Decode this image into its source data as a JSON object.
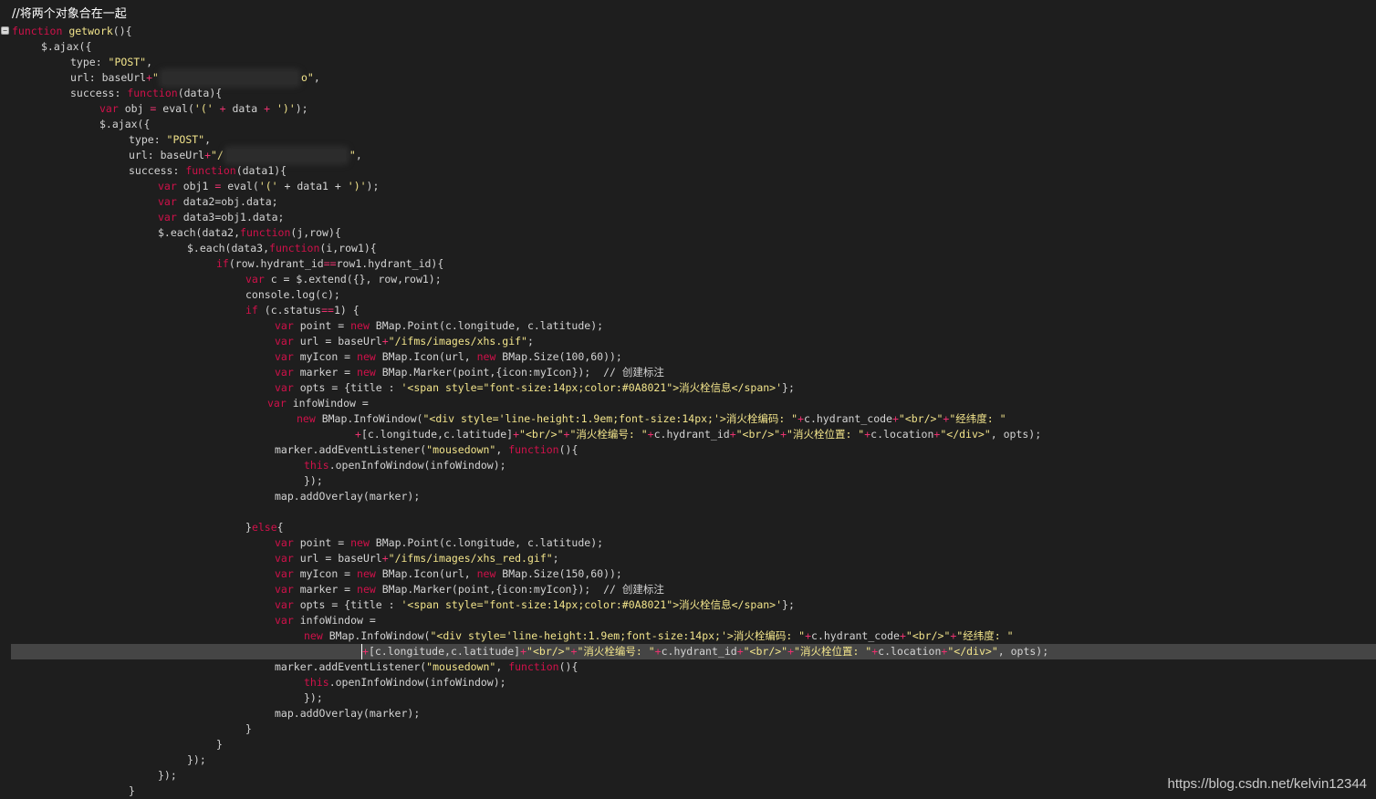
{
  "editor": {
    "header_comment": "//将两个对象合在一起",
    "watermark": "https://blog.csdn.net/kelvin12344"
  },
  "code": {
    "l2_kw": "function",
    "l2_name": "getwork",
    "l2_rest": "(){",
    "l3": "$.ajax({",
    "l4_a": "type: ",
    "l4_s": "\"POST\"",
    "l4_b": ",",
    "l5_a": "url: baseUrl",
    "l5_op": "+",
    "l5_s1": "\"",
    "l5_s2": "o\"",
    "l5_b": ",",
    "l6_a": "success: ",
    "l6_kw": "function",
    "l6_b": "(data){",
    "l7_kw": "var",
    "l7_a": " obj ",
    "l7_op": "=",
    "l7_b": " eval(",
    "l7_s1": "'('",
    "l7_c": " ",
    "l7_op2": "+",
    "l7_d": " data ",
    "l7_op3": "+",
    "l7_e": " ",
    "l7_s2": "')'",
    "l7_f": ");",
    "l8": "$.ajax({",
    "l9_a": "type: ",
    "l9_s": "\"POST\"",
    "l9_b": ",",
    "l10_a": "url: baseUrl",
    "l10_op": "+",
    "l10_s1": "\"/",
    "l10_s2": "\"",
    "l10_b": ",",
    "l11_a": "success: ",
    "l11_kw": "function",
    "l11_b": "(data1){",
    "l12_kw": "var",
    "l12_a": " obj1 ",
    "l12_op": "=",
    "l12_b": " eval(",
    "l12_s1": "'('",
    "l12_c": " + data1 + ",
    "l12_s2": "')'",
    "l12_d": ");",
    "l13_kw": "var",
    "l13_a": " data2=obj.data;",
    "l14_kw": "var",
    "l14_a": " data3=obj1.data;",
    "l15_a": "$.each(data2,",
    "l15_kw": "function",
    "l15_b": "(j,row){",
    "l16_a": "$.each(data3,",
    "l16_kw": "function",
    "l16_b": "(i,row1){",
    "l17_kw": "if",
    "l17_a": "(row.hydrant_id",
    "l17_op": "==",
    "l17_b": "row1.hydrant_id){",
    "l18_kw": "var",
    "l18_a": " c = $.extend({}, row,row1);",
    "l19": "console.log(c);",
    "l20_kw": "if",
    "l20_a": " (c.status",
    "l20_op": "==",
    "l20_b": "1) {",
    "l21_kw": "var",
    "l21_a": " point = ",
    "l21_kw2": "new",
    "l21_b": " BMap.Point(c.longitude, c.latitude);",
    "l22_kw": "var",
    "l22_a": " url = baseUrl",
    "l22_op": "+",
    "l22_s": "\"/ifms/images/xhs.gif\"",
    "l22_b": ";",
    "l23_kw": "var",
    "l23_a": " myIcon = ",
    "l23_kw2": "new",
    "l23_b": " BMap.Icon(url, ",
    "l23_kw3": "new",
    "l23_c": " BMap.Size(100,60));",
    "l24_kw": "var",
    "l24_a": " marker = ",
    "l24_kw2": "new",
    "l24_b": " BMap.Marker(point,{icon:myIcon});  ",
    "l24_cm": "// 创建标注",
    "l25_kw": "var",
    "l25_a": " opts = {title : ",
    "l25_s": "'<span style=\"font-size:14px;color:#0A8021\">消火栓信息</span>'",
    "l25_b": "};",
    "l26_kw": "var",
    "l26_a": " infoWindow =",
    "l27_kw": "new",
    "l27_a": " BMap.InfoWindow(",
    "l27_s1": "\"<div style='line-height:1.9em;font-size:14px;'>消火栓编码: \"",
    "l27_op": "+",
    "l27_b": "c.hydrant_code",
    "l27_op2": "+",
    "l27_s2": "\"<br/>\"",
    "l27_op3": "+",
    "l27_s3": "\"经纬度: \"",
    "l28_op": "+",
    "l28_a": "[c.longitude,c.latitude]",
    "l28_op2": "+",
    "l28_s1": "\"<br/>\"",
    "l28_op3": "+",
    "l28_s2": "\"消火栓编号: \"",
    "l28_op4": "+",
    "l28_b": "c.hydrant_id",
    "l28_op5": "+",
    "l28_s3": "\"<br/>\"",
    "l28_op6": "+",
    "l28_s4": "\"消火栓位置: \"",
    "l28_op7": "+",
    "l28_c": "c.location",
    "l28_op8": "+",
    "l28_s5": "\"</div>\"",
    "l28_d": ", opts);",
    "l29_a": "marker.addEventListener(",
    "l29_s": "\"mousedown\"",
    "l29_b": ", ",
    "l29_kw": "function",
    "l29_c": "(){",
    "l30_kw": "this",
    "l30_a": ".openInfoWindow(infoWindow);",
    "l31": "});",
    "l32": "map.addOverlay(marker);",
    "l34_a": "}",
    "l34_kw": "else",
    "l34_b": "{",
    "l35_kw": "var",
    "l35_a": " point = ",
    "l35_kw2": "new",
    "l35_b": " BMap.Point(c.longitude, c.latitude);",
    "l36_kw": "var",
    "l36_a": " url = baseUrl",
    "l36_op": "+",
    "l36_s": "\"/ifms/images/xhs_red.gif\"",
    "l36_b": ";",
    "l37_kw": "var",
    "l37_a": " myIcon = ",
    "l37_kw2": "new",
    "l37_b": " BMap.Icon(url, ",
    "l37_kw3": "new",
    "l37_c": " BMap.Size(150,60));",
    "l38_kw": "var",
    "l38_a": " marker = ",
    "l38_kw2": "new",
    "l38_b": " BMap.Marker(point,{icon:myIcon});  ",
    "l38_cm": "// 创建标注",
    "l39_kw": "var",
    "l39_a": " opts = {title : ",
    "l39_s": "'<span style=\"font-size:14px;color:#0A8021\">消火栓信息</span>'",
    "l39_b": "};",
    "l40_kw": "var",
    "l40_a": " infoWindow =",
    "l41_kw": "new",
    "l41_a": " BMap.InfoWindow(",
    "l41_s1": "\"<div style='line-height:1.9em;font-size:14px;'>消火栓编码: \"",
    "l41_op": "+",
    "l41_b": "c.hydrant_code",
    "l41_op2": "+",
    "l41_s2": "\"<br/>\"",
    "l41_op3": "+",
    "l41_s3": "\"经纬度: \"",
    "l42_op": "+",
    "l42_a": "[c.longitude,c.latitude]",
    "l42_op2": "+",
    "l42_s1": "\"<br/>\"",
    "l42_op3": "+",
    "l42_s2": "\"消火栓编号: \"",
    "l42_op4": "+",
    "l42_b": "c.hydrant_id",
    "l42_op5": "+",
    "l42_s3": "\"<br/>\"",
    "l42_op6": "+",
    "l42_s4": "\"消火栓位置: \"",
    "l42_op7": "+",
    "l42_c": "c.location",
    "l42_op8": "+",
    "l42_s5": "\"</div>\"",
    "l42_d": ", opts);",
    "l43_a": "marker.addEventListener(",
    "l43_s": "\"mousedown\"",
    "l43_b": ", ",
    "l43_kw": "function",
    "l43_c": "(){",
    "l44_kw": "this",
    "l44_a": ".openInfoWindow(infoWindow);",
    "l45": "});",
    "l46": "map.addOverlay(marker);",
    "l47": "}",
    "l48": "}",
    "l49": "});",
    "l50": "});",
    "l51": "}"
  }
}
